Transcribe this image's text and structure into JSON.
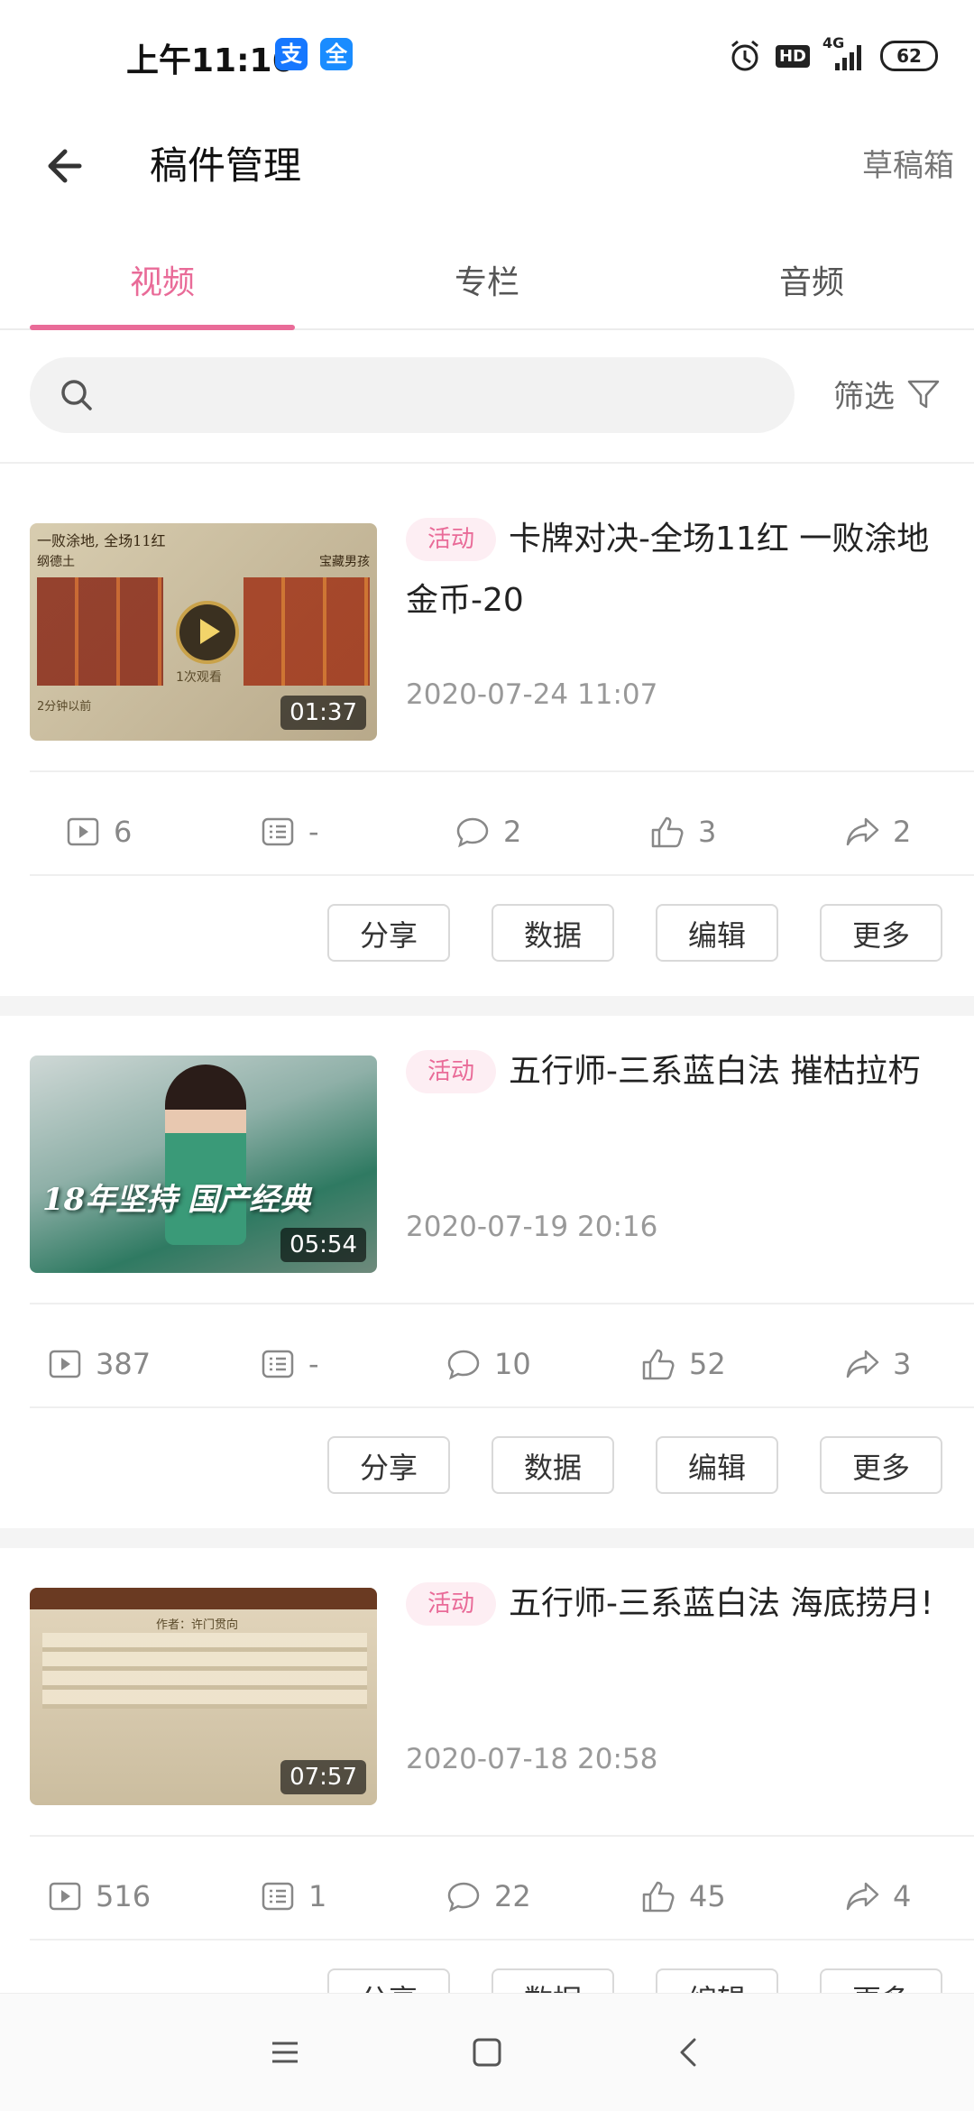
{
  "status_bar": {
    "time": "上午11:16",
    "badges": [
      {
        "label": "支",
        "color": "#1677ff"
      },
      {
        "label": "全",
        "color": "#1a8cff"
      }
    ],
    "network": "4G",
    "hd": "HD",
    "battery": "62",
    "icons": [
      "alarm-icon",
      "hd-icon",
      "signal-icon",
      "battery-icon"
    ]
  },
  "header": {
    "title": "稿件管理",
    "drafts": "草稿箱"
  },
  "tabs": [
    {
      "label": "视频",
      "active": true
    },
    {
      "label": "专栏",
      "active": false
    },
    {
      "label": "音频",
      "active": false
    }
  ],
  "search": {
    "placeholder": "",
    "filter_label": "筛选"
  },
  "accent_color": "#e96b98",
  "items": [
    {
      "tag": "活动",
      "title": "卡牌对决-全场11红 一败涂地 金币-20",
      "date": "2020-07-24 11:07",
      "duration": "01:37",
      "thumb_text": {
        "top": "一败涂地, 全场11红",
        "left": "纲德土",
        "right": "宝藏男孩",
        "center": "1次观看",
        "bottom": "2分钟以前"
      },
      "stats": {
        "plays": "6",
        "danmaku": "-",
        "comments": "2",
        "likes": "3",
        "shares": "2"
      },
      "actions": [
        "分享",
        "数据",
        "编辑",
        "更多"
      ]
    },
    {
      "tag": "活动",
      "title": "五行师-三系蓝白法 摧枯拉朽",
      "date": "2020-07-19 20:16",
      "duration": "05:54",
      "thumb_text": {
        "banner": "18年坚持 国产经典"
      },
      "stats": {
        "plays": "387",
        "danmaku": "-",
        "comments": "10",
        "likes": "52",
        "shares": "3"
      },
      "actions": [
        "分享",
        "数据",
        "编辑",
        "更多"
      ]
    },
    {
      "tag": "活动",
      "title": "五行师-三系蓝白法 海底捞月!",
      "date": "2020-07-18 20:58",
      "duration": "07:57",
      "thumb_text": {
        "author": "作者：许门贯向"
      },
      "stats": {
        "plays": "516",
        "danmaku": "1",
        "comments": "22",
        "likes": "45",
        "shares": "4"
      },
      "actions": [
        "分享",
        "数据",
        "编辑",
        "更多"
      ]
    }
  ]
}
